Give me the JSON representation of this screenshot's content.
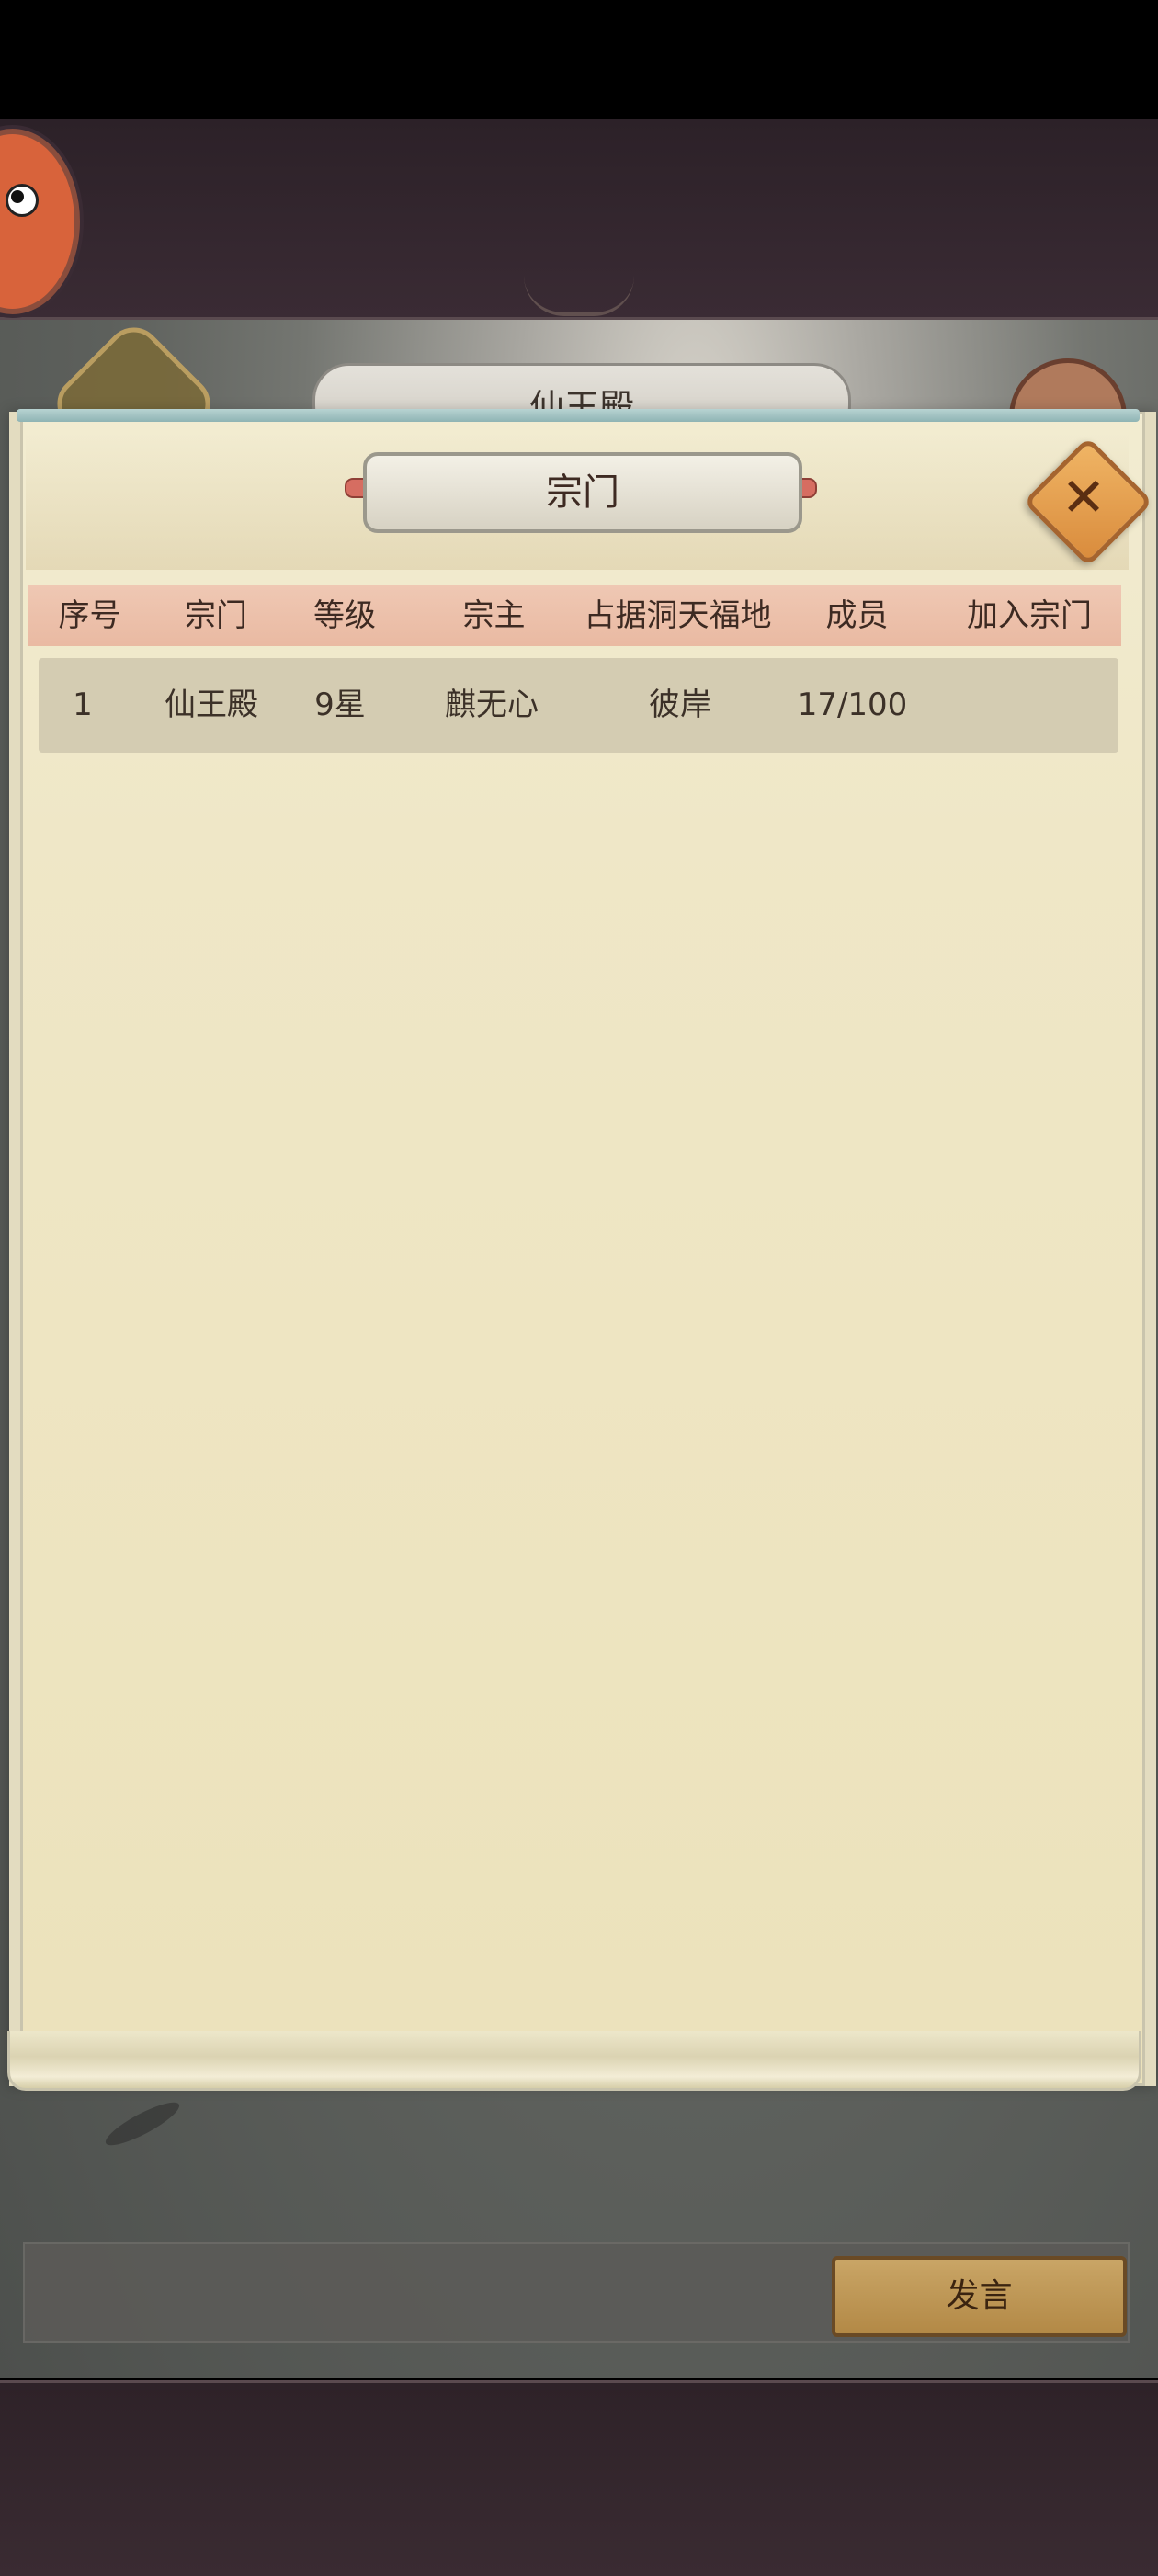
{
  "background": {
    "sect_name_plate": "仙王殿"
  },
  "dialog": {
    "title": "宗门",
    "close_icon": "close-icon"
  },
  "table": {
    "headers": [
      "序号",
      "宗门",
      "等级",
      "宗主",
      "占据洞天福地",
      "成员",
      "加入宗门"
    ],
    "rows": [
      {
        "index": "1",
        "sect": "仙王殿",
        "level": "9星",
        "leader": "麒无心",
        "territory": "彼岸",
        "members": "17/100",
        "join": ""
      }
    ]
  },
  "chat": {
    "speak_label": "发言"
  },
  "colors": {
    "scroll_bg": "#efe7c7",
    "header_bg": "#efc6b2",
    "row_bg": "#d4ccb2",
    "close_button": "#e3a254",
    "speak_button": "#c09a58"
  }
}
